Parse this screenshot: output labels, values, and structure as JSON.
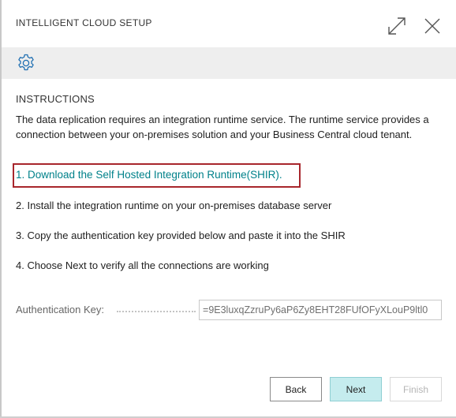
{
  "header": {
    "title": "INTELLIGENT CLOUD SETUP",
    "expand_icon": "expand-icon",
    "close_icon": "close-icon"
  },
  "toolbar": {
    "settings_icon": "gear-icon"
  },
  "instructions": {
    "heading": "INSTRUCTIONS",
    "intro": "The data replication requires an integration runtime service. The runtime service provides a connection between your on-premises solution and your Business Central cloud tenant.",
    "step1_link": "1. Download the Self Hosted Integration Runtime(SHIR).",
    "step2": "2. Install the integration runtime on your on-premises database server",
    "step3": "3. Copy the authentication key provided below and paste it into the SHIR",
    "step4": "4. Choose Next to verify all the connections are working"
  },
  "auth": {
    "label": "Authentication Key:",
    "value": "9E3luxqZzruPy6aP6Zy8EHT28FUfOFyXLouP9ltl0="
  },
  "buttons": {
    "back": "Back",
    "next": "Next",
    "finish": "Finish"
  },
  "colors": {
    "link": "#00818a",
    "highlight_border": "#a8262c",
    "primary_button": "#c5ecee",
    "toolbar_bg": "#eeeeee"
  }
}
